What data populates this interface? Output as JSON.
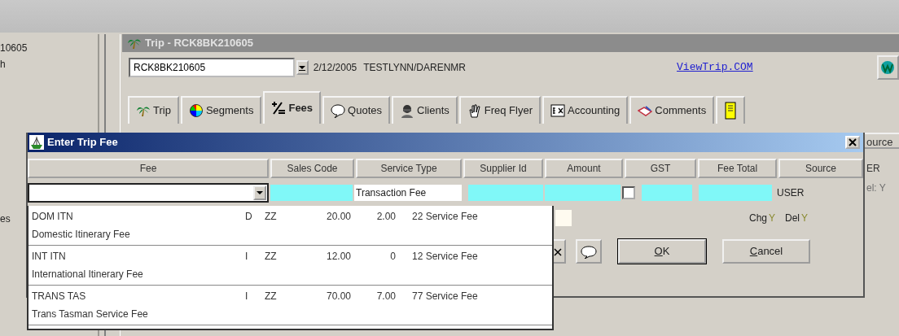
{
  "side_panel": {
    "texts": [
      "10605",
      "h",
      "es"
    ]
  },
  "trip_window": {
    "title": "Trip - RCK8BK210605",
    "record_locator": "RCK8BK210605",
    "date": "2/12/2005",
    "traveler": "TESTLYNN/DARENMR",
    "link": "ViewTrip.COM",
    "tabs": [
      {
        "label": "Trip",
        "selected": false
      },
      {
        "label": "Segments",
        "selected": false
      },
      {
        "label": "Fees",
        "selected": true
      },
      {
        "label": "Quotes",
        "selected": false
      },
      {
        "label": "Clients",
        "selected": false
      },
      {
        "label": "Freq Flyer",
        "selected": false
      },
      {
        "label": "Accounting",
        "selected": false
      },
      {
        "label": "Comments",
        "selected": false
      }
    ]
  },
  "behind_dialog": {
    "button": "ource",
    "texts": [
      "ER",
      "el: Y"
    ]
  },
  "dialog": {
    "title": "Enter Trip Fee",
    "columns": [
      "Fee",
      "Sales Code",
      "Service Type",
      "Supplier Id",
      "Amount",
      "GST",
      "Fee Total",
      "Source"
    ],
    "entry": {
      "service_type": "Transaction Fee",
      "gst_checked": false,
      "source": "USER"
    },
    "flags": [
      {
        "label": "Chg",
        "value": "Y"
      },
      {
        "label": "Del",
        "value": "Y"
      }
    ],
    "buttons": [
      {
        "label": "OK",
        "default": true
      },
      {
        "label": "Cancel",
        "default": false
      }
    ],
    "dropdown": [
      {
        "code": "DOM ITN",
        "description": "Domestic Itinerary Fee",
        "type": "D",
        "sales_code": "ZZ",
        "amount": "20.00",
        "gst": "2.00",
        "total_service": "22 Service Fee"
      },
      {
        "code": "INT ITN",
        "description": "International Itinerary Fee",
        "type": "I",
        "sales_code": "ZZ",
        "amount": "12.00",
        "gst": "0",
        "total_service": "12 Service Fee"
      },
      {
        "code": "TRANS TAS",
        "description": "Trans Tasman Service Fee",
        "type": "I",
        "sales_code": "ZZ",
        "amount": "70.00",
        "gst": "7.00",
        "total_service": "77 Service Fee"
      }
    ]
  }
}
